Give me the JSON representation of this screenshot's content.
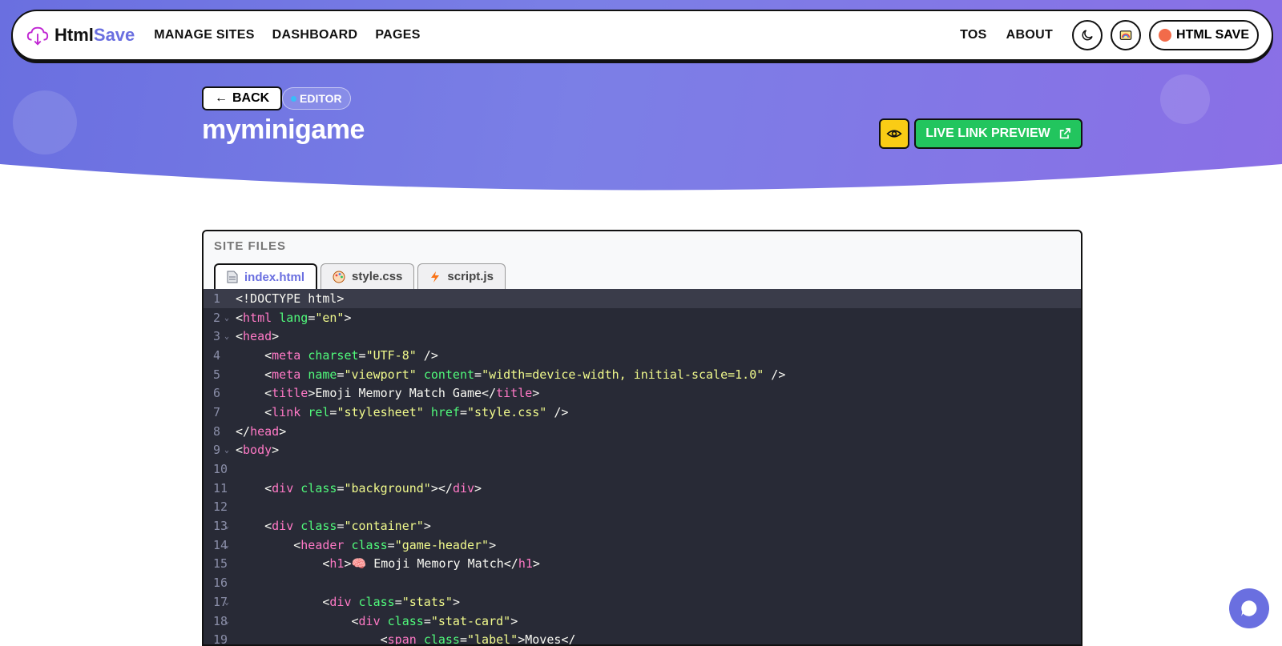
{
  "brand": {
    "name_part1": "Html",
    "name_part2": "Save"
  },
  "nav": {
    "left": [
      "MANAGE SITES",
      "DASHBOARD",
      "PAGES"
    ],
    "right": [
      "TOS",
      "ABOUT"
    ],
    "account_label": "HTML SAVE"
  },
  "header": {
    "back_label": "BACK",
    "back_arrow": "←",
    "badge_label": "EDITOR",
    "title": "myminigame",
    "live_preview_label": "LIVE LINK PREVIEW"
  },
  "files": {
    "section_label": "SITE FILES",
    "tabs": [
      {
        "label": "index.html",
        "icon": "file-icon",
        "active": true
      },
      {
        "label": "style.css",
        "icon": "palette-icon",
        "active": false
      },
      {
        "label": "script.js",
        "icon": "lightning-icon",
        "active": false
      }
    ],
    "code_lines": [
      {
        "n": "1",
        "fold": "",
        "html": "<span>&lt;!DOCTYPE html&gt;</span>"
      },
      {
        "n": "2",
        "fold": "⌄",
        "html": "&lt;<span class='t'>html</span> <span class='a'>lang</span>=<span class='s'>\"en\"</span>&gt;"
      },
      {
        "n": "3",
        "fold": "⌄",
        "html": "&lt;<span class='t'>head</span>&gt;"
      },
      {
        "n": "4",
        "fold": "",
        "html": "    &lt;<span class='t'>meta</span> <span class='a'>charset</span>=<span class='s'>\"UTF-8\"</span> /&gt;"
      },
      {
        "n": "5",
        "fold": "",
        "html": "    &lt;<span class='t'>meta</span> <span class='a'>name</span>=<span class='s'>\"viewport\"</span> <span class='a'>content</span>=<span class='s'>\"width=device-width, initial-scale=1.0\"</span> /&gt;"
      },
      {
        "n": "6",
        "fold": "",
        "html": "    &lt;<span class='t'>title</span>&gt;Emoji Memory Match Game&lt;/<span class='t'>title</span>&gt;"
      },
      {
        "n": "7",
        "fold": "",
        "html": "    &lt;<span class='t'>link</span> <span class='a'>rel</span>=<span class='s'>\"stylesheet\"</span> <span class='a'>href</span>=<span class='s'>\"style.css\"</span> /&gt;"
      },
      {
        "n": "8",
        "fold": "",
        "html": "&lt;/<span class='t'>head</span>&gt;"
      },
      {
        "n": "9",
        "fold": "⌄",
        "html": "&lt;<span class='t'>body</span>&gt;"
      },
      {
        "n": "10",
        "fold": "",
        "html": ""
      },
      {
        "n": "11",
        "fold": "",
        "html": "    &lt;<span class='t'>div</span> <span class='a'>class</span>=<span class='s'>\"background\"</span>&gt;&lt;/<span class='t'>div</span>&gt;"
      },
      {
        "n": "12",
        "fold": "",
        "html": ""
      },
      {
        "n": "13",
        "fold": "⌄",
        "html": "    &lt;<span class='t'>div</span> <span class='a'>class</span>=<span class='s'>\"container\"</span>&gt;"
      },
      {
        "n": "14",
        "fold": "⌄",
        "html": "        &lt;<span class='t'>header</span> <span class='a'>class</span>=<span class='s'>\"game-header\"</span>&gt;"
      },
      {
        "n": "15",
        "fold": "",
        "html": "            &lt;<span class='t'>h1</span>&gt;🧠 Emoji Memory Match&lt;/<span class='t'>h1</span>&gt;"
      },
      {
        "n": "16",
        "fold": "",
        "html": ""
      },
      {
        "n": "17",
        "fold": "⌄",
        "html": "            &lt;<span class='t'>div</span> <span class='a'>class</span>=<span class='s'>\"stats\"</span>&gt;"
      },
      {
        "n": "18",
        "fold": "⌄",
        "html": "                &lt;<span class='t'>div</span> <span class='a'>class</span>=<span class='s'>\"stat-card\"</span>&gt;"
      },
      {
        "n": "19",
        "fold": "",
        "html": "                    &lt;<span class='t'>span</span> <span class='a'>class</span>=<span class='s'>\"label\"</span>&gt;Moves&lt;/"
      }
    ]
  },
  "colors": {
    "accent": "#6a6fe0",
    "live": "#22c55e",
    "eye": "#facc15",
    "code_bg": "#282a36"
  }
}
